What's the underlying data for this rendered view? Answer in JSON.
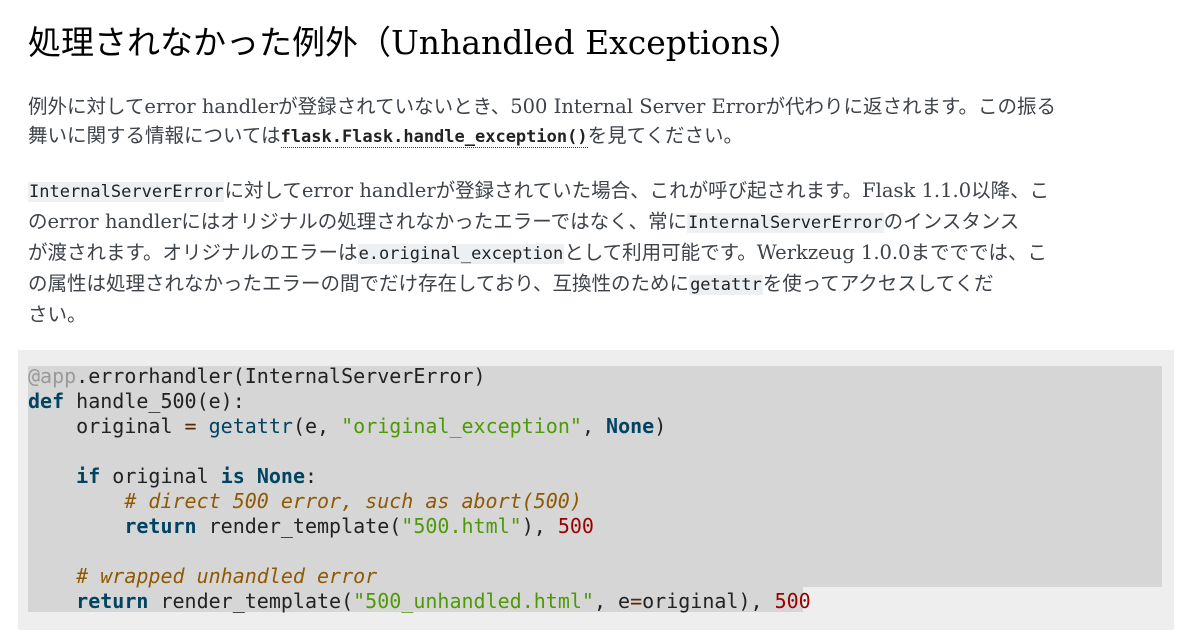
{
  "heading": "処理されなかった例外（Unhandled Exceptions）",
  "paragraph1": {
    "line1": "例外に対してerror handlerが登録されていないとき、500 Internal Server Errorが代わりに返されます。この振る",
    "line2_before": "舞いに関する情報については",
    "line2_link": "flask.Flask.handle_exception()",
    "line2_after": "を見てください。"
  },
  "paragraph2": {
    "l1_code": "InternalServerError",
    "l1_text": "に対してerror handlerが登録されていた場合、これが呼び起されます。Flask 1.1.0以降、こ",
    "l2_text": "のerror handlerにはオリジナルの処理されなかったエラーではなく、常に",
    "l2_code": "InternalServerError",
    "l2_after": "のインスタンス",
    "l3_text": "が渡されます。オリジナルのエラーは",
    "l3_code": "e.original_exception",
    "l3_after": "として利用可能です。Werkzeug 1.0.0までででは、こ",
    "l4_text": "の属性は処理されなかったエラーの間でだけ存在しており、互換性のために",
    "l4_code": "getattr",
    "l4_after": "を使ってアクセスしてくだ",
    "l5_text": "さい。"
  },
  "code": {
    "decorator": "@app",
    "decorator_rest": ".errorhandler(InternalServerError)",
    "l2_def": "def",
    "l2_rest": " handle_500(e):",
    "l3_indent": "    original ",
    "l3_eq": "=",
    "l3_space": " ",
    "l3_getattr": "getattr",
    "l3_args": "(e, ",
    "l3_str": "\"original_exception\"",
    "l3_comma": ", ",
    "l3_none": "None",
    "l3_close": ")",
    "l5_indent": "    ",
    "l5_if": "if",
    "l5_mid": " original ",
    "l5_is": "is",
    "l5_sp": " ",
    "l5_none": "None",
    "l5_colon": ":",
    "l6_indent": "        ",
    "l6_comment": "# direct 500 error, such as abort(500)",
    "l7_indent": "        ",
    "l7_return": "return",
    "l7_call": " render_template(",
    "l7_str": "\"500.html\"",
    "l7_close": "), ",
    "l7_num": "500",
    "l9_indent": "    ",
    "l9_comment": "# wrapped unhandled error",
    "l10_indent": "    ",
    "l10_return": "return",
    "l10_call": " render_template(",
    "l10_str": "\"500_unhandled.html\"",
    "l10_comma": ", e",
    "l10_eq": "=",
    "l10_orig": "original), ",
    "l10_num": "500"
  }
}
